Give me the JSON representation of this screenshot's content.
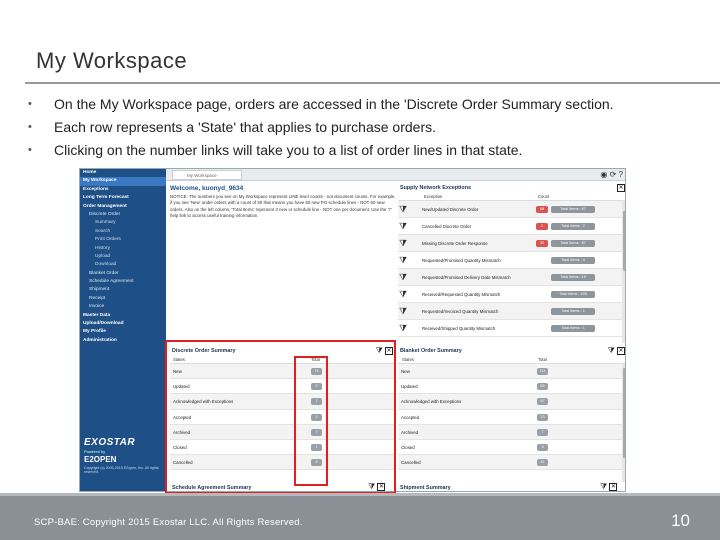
{
  "slide": {
    "title": "My Workspace",
    "bullets": [
      "On the My Workspace page, orders are accessed in the 'Discrete Order Summary section.",
      "Each row represents a 'State' that applies to purchase orders.",
      "Clicking on the number links will take you to a list of order lines in that state."
    ],
    "footer": "SCP-BAE:  Copyright 2015 Exostar LLC. All Rights Reserved.",
    "page_number": "10"
  },
  "app": {
    "tab_label": "My Workspace",
    "sidebar": [
      {
        "label": "Home",
        "level": 0
      },
      {
        "label": "My Workspace",
        "level": 0,
        "active": true
      },
      {
        "label": "Exceptions",
        "level": 0
      },
      {
        "label": "Long Term Forecast",
        "level": 0
      },
      {
        "label": "Order Management",
        "level": 0
      },
      {
        "label": "Discrete Order",
        "level": 1
      },
      {
        "label": "Summary",
        "level": 2
      },
      {
        "label": "Search",
        "level": 2
      },
      {
        "label": "Print Orders",
        "level": 2
      },
      {
        "label": "History",
        "level": 2
      },
      {
        "label": "Upload",
        "level": 2
      },
      {
        "label": "Download",
        "level": 2
      },
      {
        "label": "Blanket Order",
        "level": 1
      },
      {
        "label": "Schedule Agreement",
        "level": 1
      },
      {
        "label": "Shipment",
        "level": 1
      },
      {
        "label": "Receipt",
        "level": 1
      },
      {
        "label": "Invoice",
        "level": 1
      },
      {
        "label": "Master Data",
        "level": 0
      },
      {
        "label": "Upload/Download",
        "level": 0
      },
      {
        "label": "My Profile",
        "level": 0
      },
      {
        "label": "Administration",
        "level": 0
      }
    ],
    "logo": {
      "brand": "EXOSTAR",
      "powered": "Powered by",
      "product": "E2OPEN",
      "copyright": "Copyright (c) 2000-2015 E2open, Inc. All rights reserved."
    },
    "welcome": {
      "heading": "Welcome, kuonyd_9634",
      "notice": "NOTICE: The numbers you see on My Workspace represent LINE level counts - not document counts. For example, if you see 'New' under orders with a count of 50 that means you have 50 new PO schedule lines - NOT 50 new orders. Also on the left column, 'Total Items' represent 3 new or schedule line - NOT one per document. Use the '?' help link to access useful training information."
    },
    "sne": {
      "title": "Supply Network Exceptions",
      "col_exception": "Exception",
      "col_count": "Count",
      "rows": [
        {
          "label": "New/Updated Discrete Order",
          "badge": "68",
          "total": "Total Items : 67",
          "red": true
        },
        {
          "label": "Cancelled Discrete Order",
          "badge": "2",
          "total": "Total Items : 2",
          "red": true
        },
        {
          "label": "Missing Discrete Order Response",
          "badge": "30",
          "total": "Total Items : 87",
          "red": true
        },
        {
          "label": "Requested/Promised Quantity Mismatch",
          "badge": "",
          "total": "Total Items : 4",
          "red": false
        },
        {
          "label": "Requested/Promised Delivery Date Mismatch",
          "badge": "",
          "total": "Total Items : 15",
          "red": false
        },
        {
          "label": "Received/Requested Quantity Mismatch",
          "badge": "",
          "total": "Total Items : 205",
          "red": false
        },
        {
          "label": "Requested/Invoiced Quantity Mismatch",
          "badge": "",
          "total": "Total Items : 1",
          "red": false
        },
        {
          "label": "Received/Shipped Quantity Mismatch",
          "badge": "",
          "total": "Total Items : 1",
          "red": false
        }
      ]
    },
    "dos": {
      "title": "Discrete Order Summary",
      "col_states": "States",
      "col_total": "Total",
      "rows": [
        {
          "state": "New",
          "total": "74"
        },
        {
          "state": "Updated",
          "total": "2"
        },
        {
          "state": "Acknowledged with Exceptions",
          "total": "7"
        },
        {
          "state": "Accepted",
          "total": "2"
        },
        {
          "state": "Archived",
          "total": "7"
        },
        {
          "state": "Closed",
          "total": "1"
        },
        {
          "state": "Cancelled",
          "total": "2"
        }
      ]
    },
    "bos": {
      "title": "Blanket Order Summary",
      "col_states": "States",
      "col_total": "Total",
      "rows": [
        {
          "state": "New",
          "total": "111"
        },
        {
          "state": "Updated",
          "total": "59"
        },
        {
          "state": "Acknowledged with Exceptions",
          "total": "67"
        },
        {
          "state": "Accepted",
          "total": "73"
        },
        {
          "state": "Archived",
          "total": "7"
        },
        {
          "state": "Closed",
          "total": "3"
        },
        {
          "state": "Cancelled",
          "total": "41"
        }
      ]
    },
    "bottom_titles": {
      "left": "Schedule Agreement Summary",
      "right": "Shipment Summary"
    }
  },
  "colors": {
    "sidebar": "#1e4f86",
    "highlight": "#e02020",
    "footer": "#8a9096",
    "badge_red": "#d9534f"
  }
}
